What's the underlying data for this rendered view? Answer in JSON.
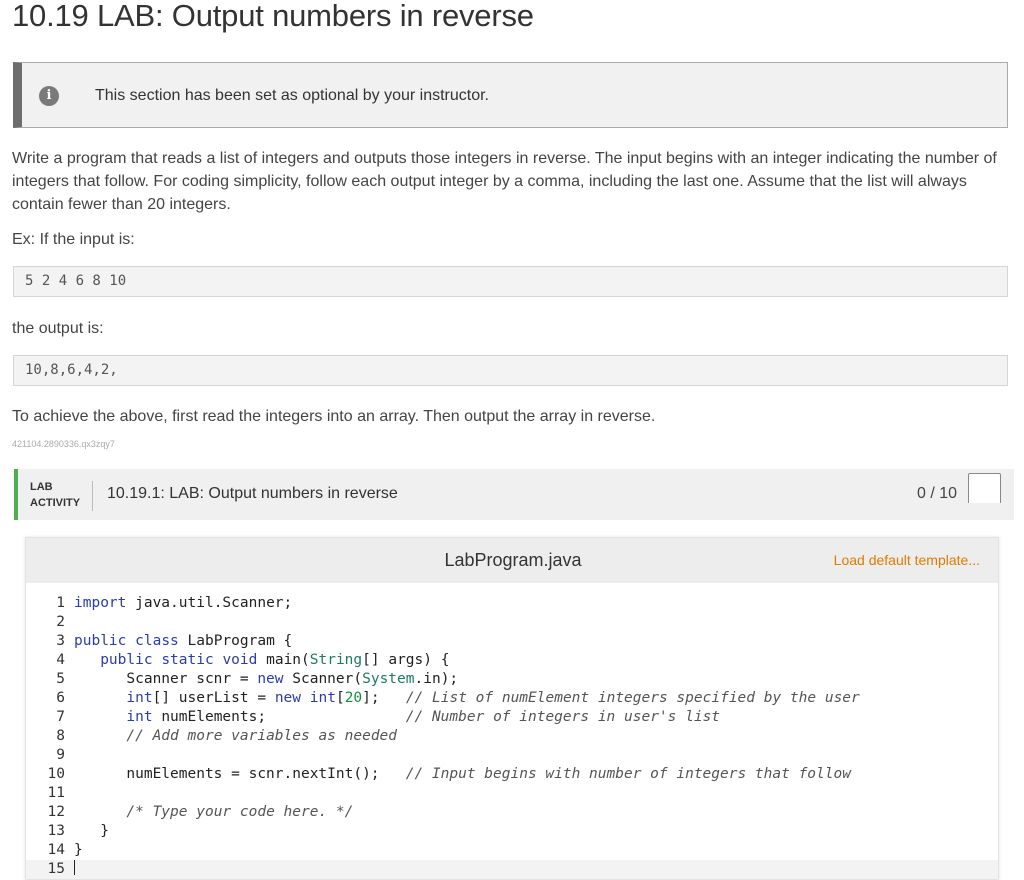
{
  "page": {
    "title": "10.19 LAB: Output numbers in reverse",
    "notice": "This section has been set as optional by your instructor.",
    "description": "Write a program that reads a list of integers and outputs those integers in reverse. The input begins with an integer indicating the number of integers that follow. For coding simplicity, follow each output integer by a comma, including the last one. Assume that the list will always contain fewer than 20 integers.",
    "example_input_label": "Ex: If the input is:",
    "example_input": "5 2 4 6 8 10",
    "example_output_label": "the output is:",
    "example_output": "10,8,6,4,2,",
    "hint": "To achieve the above, first read the integers into an array. Then output the array in reverse.",
    "section_id": "421104.2890336.qx3zqy7"
  },
  "lab": {
    "tag_line1": "LAB",
    "tag_line2": "ACTIVITY",
    "title": "10.19.1: LAB: Output numbers in reverse",
    "score": "0 / 10"
  },
  "editor": {
    "filename": "LabProgram.java",
    "load_template": "Load default template..."
  },
  "code_lines": [
    "import java.util.Scanner;",
    "",
    "public class LabProgram {",
    "   public static void main(String[] args) {",
    "      Scanner scnr = new Scanner(System.in);",
    "      int[] userList = new int[20];   // List of numElement integers specified by the user",
    "      int numElements;                // Number of integers in user's list",
    "      // Add more variables as needed",
    "",
    "      numElements = scnr.nextInt();   // Input begins with number of integers that follow",
    "",
    "      /* Type your code here. */",
    "   }",
    "}",
    ""
  ],
  "colors": {
    "accent_green": "#4caf50",
    "load_link": "#e07b00",
    "keyword": "#2a3ea6",
    "class_name": "#1f7a5e",
    "number": "#1a8f3a"
  },
  "icons": [
    "info-icon"
  ]
}
